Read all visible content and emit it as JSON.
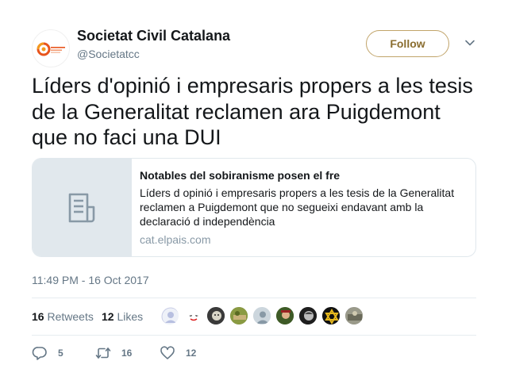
{
  "account": {
    "display_name": "Societat Civil Catalana",
    "handle": "@Societatcc",
    "avatar_icon": "societat-civil-catalana-logo"
  },
  "follow_button": {
    "label": "Follow"
  },
  "tweet": {
    "text": "Líders d'opinió i empresaris propers a les tesis de la Generalitat reclamen ara Puigdemont que no faci una DUI",
    "timestamp": "11:49 PM - 16 Oct 2017"
  },
  "card": {
    "title": "Notables del sobiranisme posen el fre",
    "description": "Líders d opinió i empresaris propers a les tesis de la Generalitat reclamen a Puigdemont que no segueixi endavant amb la declaració d independència",
    "domain": "cat.elpais.com",
    "media_icon": "document-icon"
  },
  "stats": {
    "retweets_count": "16",
    "retweets_label": "Retweets",
    "likes_count": "12",
    "likes_label": "Likes"
  },
  "actions": {
    "reply_count": "5",
    "retweet_count": "16",
    "like_count": "12"
  },
  "colors": {
    "follow_border": "#c1a46a",
    "follow_text": "#8a6d2f",
    "muted": "#657786",
    "card_placeholder": "#e1e8ed"
  }
}
